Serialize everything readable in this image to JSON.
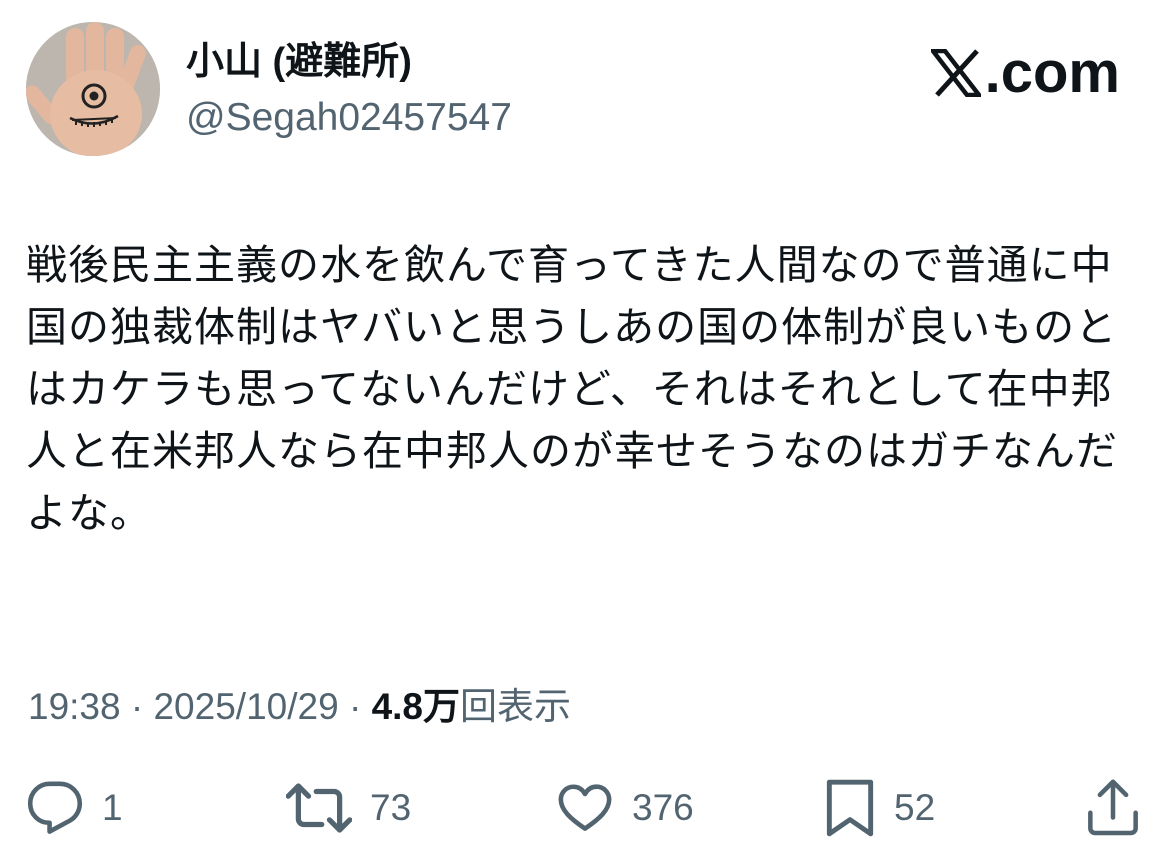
{
  "author": {
    "display_name": "小山 (避難所)",
    "handle": "@Segah02457547"
  },
  "brand": {
    "label": "com",
    "icon": "x-logo-icon"
  },
  "tweet": {
    "text": "戦後民主主義の水を飲んで育ってきた人間なので普通に中国の独裁体制はヤバいと思うしあの国の体制が良いものとはカケラも思ってないんだけど、それはそれとして在中邦人と在米邦人なら在中邦人のが幸せそうなのはガチなんだよな。"
  },
  "meta": {
    "time": "19:38",
    "separator": " · ",
    "date": "2025/10/29",
    "views_count": "4.8万",
    "views_label": "回表示"
  },
  "actions": {
    "reply": {
      "icon": "reply-icon",
      "count": "1"
    },
    "retweet": {
      "icon": "retweet-icon",
      "count": "73"
    },
    "like": {
      "icon": "heart-icon",
      "count": "376"
    },
    "bookmark": {
      "icon": "bookmark-icon",
      "count": "52"
    },
    "share": {
      "icon": "share-icon"
    }
  },
  "colors": {
    "text_primary": "#0f1419",
    "text_secondary": "#536471"
  }
}
